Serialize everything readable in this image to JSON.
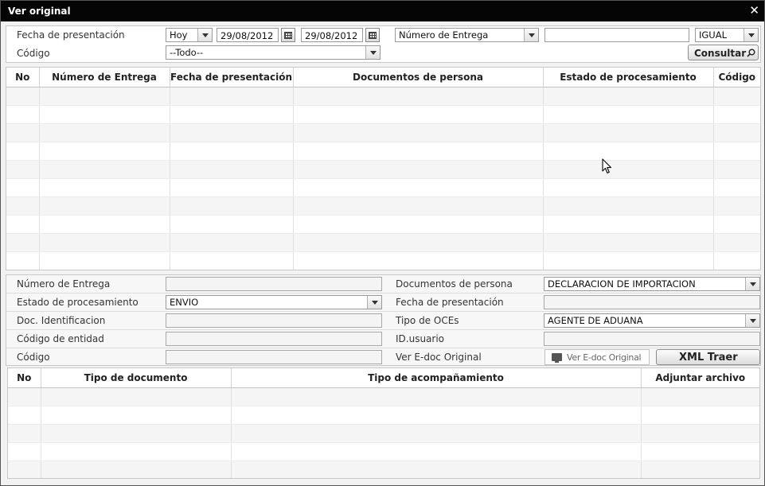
{
  "window": {
    "title": "Ver original",
    "close_icon": "close-icon"
  },
  "search": {
    "fecha_label": "Fecha de presentación",
    "period_value": "Hoy",
    "date_from": "29/08/2012",
    "date_to": "29/08/2012",
    "field_select": "Número de Entrega",
    "field_value": "",
    "operator_select": "IGUAL",
    "codigo_label": "Código",
    "codigo_select": "--Todo--",
    "consultar_label": "Consultar"
  },
  "results_table": {
    "columns": [
      "No",
      "Número de Entrega",
      "Fecha de presentación",
      "Documentos de persona",
      "Estado de procesamiento",
      "Código"
    ],
    "rows": [
      [
        "",
        "",
        "",
        "",
        "",
        ""
      ],
      [
        "",
        "",
        "",
        "",
        "",
        ""
      ],
      [
        "",
        "",
        "",
        "",
        "",
        ""
      ],
      [
        "",
        "",
        "",
        "",
        "",
        ""
      ],
      [
        "",
        "",
        "",
        "",
        "",
        ""
      ],
      [
        "",
        "",
        "",
        "",
        "",
        ""
      ],
      [
        "",
        "",
        "",
        "",
        "",
        ""
      ],
      [
        "",
        "",
        "",
        "",
        "",
        ""
      ],
      [
        "",
        "",
        "",
        "",
        "",
        ""
      ],
      [
        "",
        "",
        "",
        "",
        "",
        ""
      ]
    ]
  },
  "detail": {
    "numero_entrega_label": "Número de Entrega",
    "numero_entrega_value": "",
    "documentos_persona_label": "Documentos de persona",
    "documentos_persona_value": "DECLARACION DE IMPORTACION",
    "estado_label": "Estado de procesamiento",
    "estado_value": "ENVIO",
    "fecha_label": "Fecha de presentación",
    "fecha_value": "",
    "doc_ident_label": "Doc. Identificacion",
    "doc_ident_value": "",
    "tipo_oces_label": "Tipo de OCEs",
    "tipo_oces_value": "AGENTE DE ADUANA",
    "codigo_entidad_label": "Código de entidad",
    "codigo_entidad_value": "",
    "id_usuario_label": "ID.usuario",
    "id_usuario_value": "",
    "codigo_label": "Código",
    "codigo_value": "",
    "ver_edoc_label": "Ver E-doc Original",
    "ver_edoc_button": "Ver E-doc Original",
    "xml_traer_label": "XML Traer"
  },
  "attachments_table": {
    "columns": [
      "No",
      "Tipo de documento",
      "Tipo de acompañamiento",
      "Adjuntar archivo"
    ],
    "rows": [
      [
        "",
        "",
        "",
        ""
      ],
      [
        "",
        "",
        "",
        ""
      ],
      [
        "",
        "",
        "",
        ""
      ],
      [
        "",
        "",
        "",
        ""
      ],
      [
        "",
        "",
        "",
        ""
      ]
    ]
  },
  "colors": {
    "titlebar": "#050505",
    "row_alt": "#f5f5f5",
    "border": "#c8c8c8"
  }
}
